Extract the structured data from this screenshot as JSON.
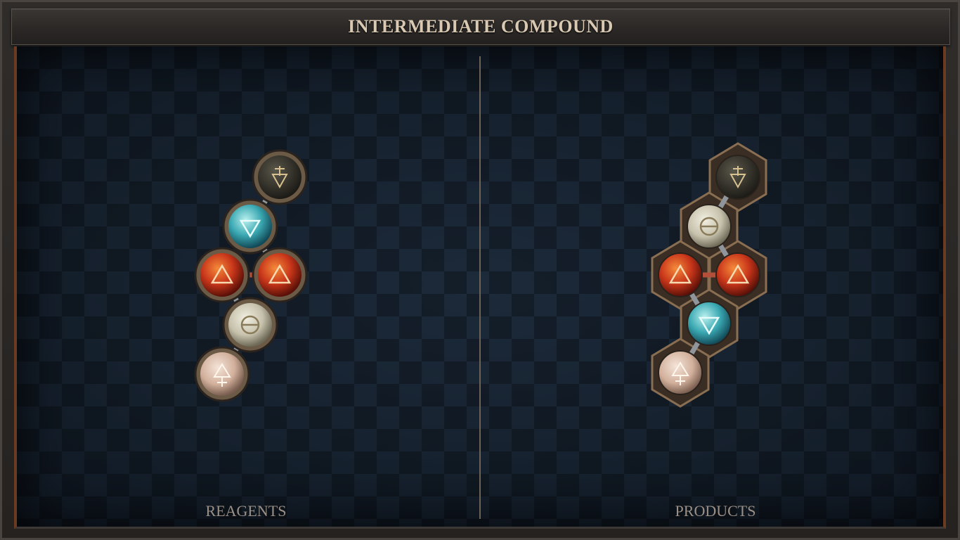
{
  "header": {
    "title": "INTERMEDIATE COMPOUND"
  },
  "reagents": {
    "label": "REAGENTS",
    "atoms": [
      {
        "symbol": "earth",
        "color": "#3b3a30"
      },
      {
        "symbol": "water",
        "color": "#4fb8c0"
      },
      {
        "symbol": "fire",
        "color": "#d4431a"
      },
      {
        "symbol": "fire",
        "color": "#d4431a"
      },
      {
        "symbol": "salt",
        "color": "#cfcbb6"
      },
      {
        "symbol": "air",
        "color": "#d6b6a4"
      }
    ]
  },
  "products": {
    "label": "PRODUCTS",
    "atoms": [
      {
        "symbol": "earth",
        "color": "#3b3a30"
      },
      {
        "symbol": "salt",
        "color": "#cfcbb6"
      },
      {
        "symbol": "fire",
        "color": "#d4431a"
      },
      {
        "symbol": "fire",
        "color": "#d4431a"
      },
      {
        "symbol": "water",
        "color": "#4fb8c0"
      },
      {
        "symbol": "air",
        "color": "#d6b6a4"
      }
    ]
  }
}
